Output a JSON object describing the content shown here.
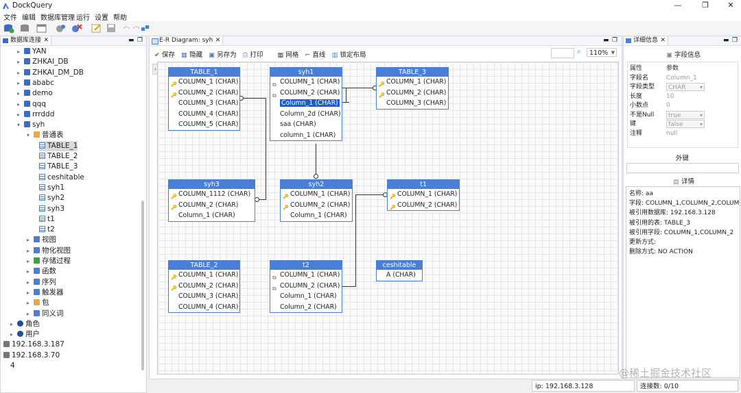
{
  "window": {
    "title": "DockQuery",
    "min": "—",
    "max": "❐",
    "close": "✕"
  },
  "menu": [
    "文件",
    "编辑",
    "数据库管理",
    "运行",
    "设置",
    "帮助"
  ],
  "left_panel": {
    "tab": "数据库连接",
    "tree": [
      {
        "label": "YAN",
        "icon": "db"
      },
      {
        "label": "ZHKAI_DB",
        "icon": "db"
      },
      {
        "label": "ZHKAI_DM_DB",
        "icon": "db"
      },
      {
        "label": "ababc",
        "icon": "db"
      },
      {
        "label": "demo",
        "icon": "db"
      },
      {
        "label": "qqq",
        "icon": "db"
      },
      {
        "label": "rrrddd",
        "icon": "db"
      },
      {
        "label": "syh",
        "icon": "db"
      },
      {
        "label": "普通表",
        "icon": "folder"
      },
      {
        "label": "TABLE_1",
        "icon": "table"
      },
      {
        "label": "TABLE_2",
        "icon": "table"
      },
      {
        "label": "TABLE_3",
        "icon": "table"
      },
      {
        "label": "ceshitable",
        "icon": "table"
      },
      {
        "label": "syh1",
        "icon": "table"
      },
      {
        "label": "syh2",
        "icon": "table"
      },
      {
        "label": "syh3",
        "icon": "table"
      },
      {
        "label": "t1",
        "icon": "table"
      },
      {
        "label": "t2",
        "icon": "table"
      },
      {
        "label": "视图",
        "icon": "view"
      },
      {
        "label": "物化视图",
        "icon": "view"
      },
      {
        "label": "存储过程",
        "icon": "proc"
      },
      {
        "label": "函数",
        "icon": "func"
      },
      {
        "label": "序列",
        "icon": "seq"
      },
      {
        "label": "触发器",
        "icon": "trig"
      },
      {
        "label": "包",
        "icon": "pkg"
      },
      {
        "label": "同义词",
        "icon": "syn"
      },
      {
        "label": "角色",
        "icon": "role"
      },
      {
        "label": "用户",
        "icon": "user"
      },
      {
        "label": "192.168.3.187",
        "icon": "server"
      },
      {
        "label": "192.168.3.70",
        "icon": "server"
      },
      {
        "label": "4",
        "icon": "none"
      }
    ]
  },
  "editor": {
    "tab": "E-R Diagram: syh",
    "toolbar": {
      "save": "保存",
      "hide": "隐藏",
      "save_as": "另存为",
      "print": "打印",
      "grid": "网格",
      "line": "直线",
      "lock": "锁定布局"
    },
    "zoom": "110%",
    "entities": [
      {
        "name": "TABLE_1",
        "rows": [
          {
            "t": "COLUMN_1 (CHAR)",
            "k": "key"
          },
          {
            "t": "COLUMN_2 (CHAR)",
            "k": "key"
          },
          {
            "t": "COLUMN_3 (CHAR)",
            "k": ""
          },
          {
            "t": "COLUMN_4 (CHAR)",
            "k": ""
          },
          {
            "t": "COLUMN_5 (CHAR)",
            "k": ""
          }
        ]
      },
      {
        "name": "syh1",
        "rows": [
          {
            "t": "COLUMN_1 (CHAR)",
            "k": "link"
          },
          {
            "t": "COLUMN_2 (CHAR)",
            "k": "link"
          },
          {
            "t": "Column_1 (CHAR)",
            "k": "",
            "sel": true
          },
          {
            "t": "Column_2d (CHAR)",
            "k": ""
          },
          {
            "t": "saa (CHAR)",
            "k": ""
          },
          {
            "t": "column_1 (CHAR)",
            "k": ""
          }
        ]
      },
      {
        "name": "TABLE_3",
        "rows": [
          {
            "t": "COLUMN_1 (CHAR)",
            "k": "key"
          },
          {
            "t": "COLUMN_2 (CHAR)",
            "k": "key"
          },
          {
            "t": "COLUMN_3 (CHAR)",
            "k": ""
          }
        ]
      },
      {
        "name": "syh3",
        "rows": [
          {
            "t": "COLUMN_1112 (CHAR)",
            "k": "key"
          },
          {
            "t": "COLUMN_2 (CHAR)",
            "k": "key"
          },
          {
            "t": "Column_1 (CHAR)",
            "k": ""
          }
        ]
      },
      {
        "name": "syh2",
        "rows": [
          {
            "t": "COLUMN_1 (CHAR)",
            "k": "key"
          },
          {
            "t": "COLUMN_2 (CHAR)",
            "k": "key"
          },
          {
            "t": "Column_1 (CHAR)",
            "k": ""
          }
        ]
      },
      {
        "name": "t1",
        "rows": [
          {
            "t": "COLUMN_1 (CHAR)",
            "k": "key"
          },
          {
            "t": "COLUMN_2 (CHAR)",
            "k": "key"
          }
        ]
      },
      {
        "name": "TABLE_2",
        "rows": [
          {
            "t": "COLUMN_1 (CHAR)",
            "k": "key"
          },
          {
            "t": "COLUMN_2 (CHAR)",
            "k": "key"
          },
          {
            "t": "COLUMN_3 (CHAR)",
            "k": ""
          },
          {
            "t": "COLUMN_4 (CHAR)",
            "k": ""
          }
        ]
      },
      {
        "name": "t2",
        "rows": [
          {
            "t": "COLUMN_1 (CHAR)",
            "k": "link"
          },
          {
            "t": "COLUMN_2 (CHAR)",
            "k": "link"
          },
          {
            "t": "Column_1 (CHAR)",
            "k": ""
          },
          {
            "t": "Column_2 (CHAR)",
            "k": ""
          }
        ]
      },
      {
        "name": "ceshitable",
        "rows": [
          {
            "t": "A (CHAR)",
            "k": ""
          }
        ]
      }
    ]
  },
  "details": {
    "tab": "详细信息",
    "field_info_title": "字段信息",
    "props": [
      {
        "k": "属性",
        "v": "参数",
        "type": "header"
      },
      {
        "k": "字段名",
        "v": "Column_1",
        "type": "text"
      },
      {
        "k": "字段类型",
        "v": "CHAR",
        "type": "drop"
      },
      {
        "k": "长度",
        "v": "10",
        "type": "text"
      },
      {
        "k": "小数点",
        "v": "0",
        "type": "text"
      },
      {
        "k": "不是Null",
        "v": "true",
        "type": "drop"
      },
      {
        "k": "键",
        "v": "false",
        "type": "drop"
      },
      {
        "k": "注释",
        "v": "null",
        "type": "text"
      }
    ],
    "fk_title": "外键",
    "detail_title": "详情",
    "detail_lines": [
      "名称: aa",
      "字段: COLUMN_1,COLUMN_2,COLUMN",
      "被引用数据库: 192.168.3.128",
      "被引用的表: TABLE_3",
      "被引用字段: COLUMN_1,COLUMN_2",
      "更新方式:",
      "删除方式: NO ACTION"
    ]
  },
  "status": {
    "ip": "ip: 192.168.3.128",
    "conn": "连接数: 0/10"
  },
  "watermark": "@稀土掘金技术社区"
}
